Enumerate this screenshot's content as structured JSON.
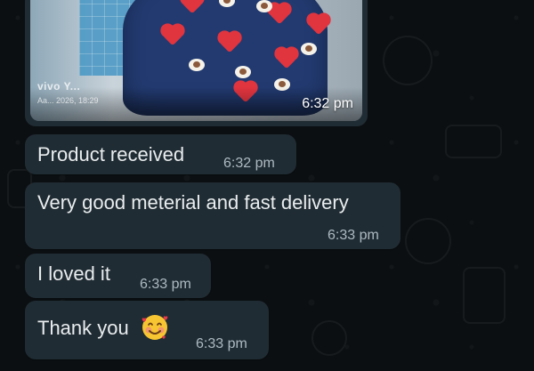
{
  "image_message": {
    "watermark": "vivo Y...",
    "caption": "Aa... 2026, 18:29",
    "time": "6:32 pm"
  },
  "messages": [
    {
      "text": "Product received",
      "time": "6:32 pm"
    },
    {
      "text": "Very good meterial and fast delivery",
      "time": "6:33 pm"
    },
    {
      "text": "I loved it",
      "time": "6:33 pm"
    },
    {
      "text": "Thank you",
      "time": "6:33 pm",
      "emoji": "smiling-face-with-hearts"
    }
  ],
  "colors": {
    "background": "#0b0f12",
    "bubble": "#202c33",
    "text": "#e9edef",
    "timestamp": "#aebac1"
  }
}
